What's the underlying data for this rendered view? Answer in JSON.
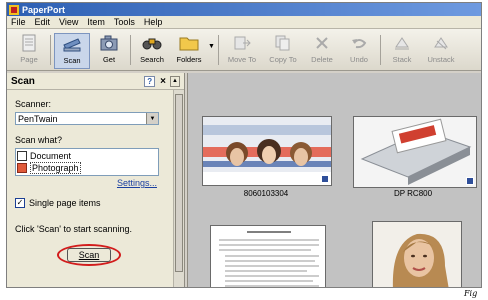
{
  "window": {
    "title": "PaperPort"
  },
  "menu": [
    "File",
    "Edit",
    "View",
    "Item",
    "Tools",
    "Help"
  ],
  "toolbar": [
    {
      "label": "Page",
      "icon": "page-icon",
      "enabled": false
    },
    {
      "label": "Scan",
      "icon": "scanner-icon",
      "enabled": true,
      "active": true
    },
    {
      "label": "Get",
      "icon": "camera-icon",
      "enabled": true
    },
    {
      "label": "Search",
      "icon": "binoculars-icon",
      "enabled": true
    },
    {
      "label": "Folders",
      "icon": "folder-icon",
      "enabled": true
    },
    {
      "label": "Move To",
      "icon": "move-to-icon",
      "enabled": false
    },
    {
      "label": "Copy To",
      "icon": "copy-to-icon",
      "enabled": false
    },
    {
      "label": "Delete",
      "icon": "delete-icon",
      "enabled": false
    },
    {
      "label": "Undo",
      "icon": "undo-icon",
      "enabled": false
    },
    {
      "label": "Stack",
      "icon": "stack-icon",
      "enabled": false
    },
    {
      "label": "Unstack",
      "icon": "unstack-icon",
      "enabled": false
    }
  ],
  "scan_pane": {
    "title": "Scan",
    "help": "?",
    "close": "×",
    "scanner_label": "Scanner:",
    "scanner_value": "PenTwain",
    "scan_what_label": "Scan what?",
    "scan_what_options": [
      "Document",
      "Photograph"
    ],
    "selected_option": "Photograph",
    "settings_link": "Settings...",
    "single_page_label": "Single page items",
    "single_page_checked": true,
    "hint": "Click 'Scan' to start scanning.",
    "scan_button": "Scan"
  },
  "thumbnails": [
    {
      "label": "8060103304"
    },
    {
      "label": "DP RC800"
    },
    {
      "label": ""
    },
    {
      "label": ""
    }
  ],
  "caption": "Fig",
  "colors": {
    "title_bar": "#2d5fb3",
    "highlight_ring": "#d21c1c",
    "workspace": "#c2c2c2"
  }
}
